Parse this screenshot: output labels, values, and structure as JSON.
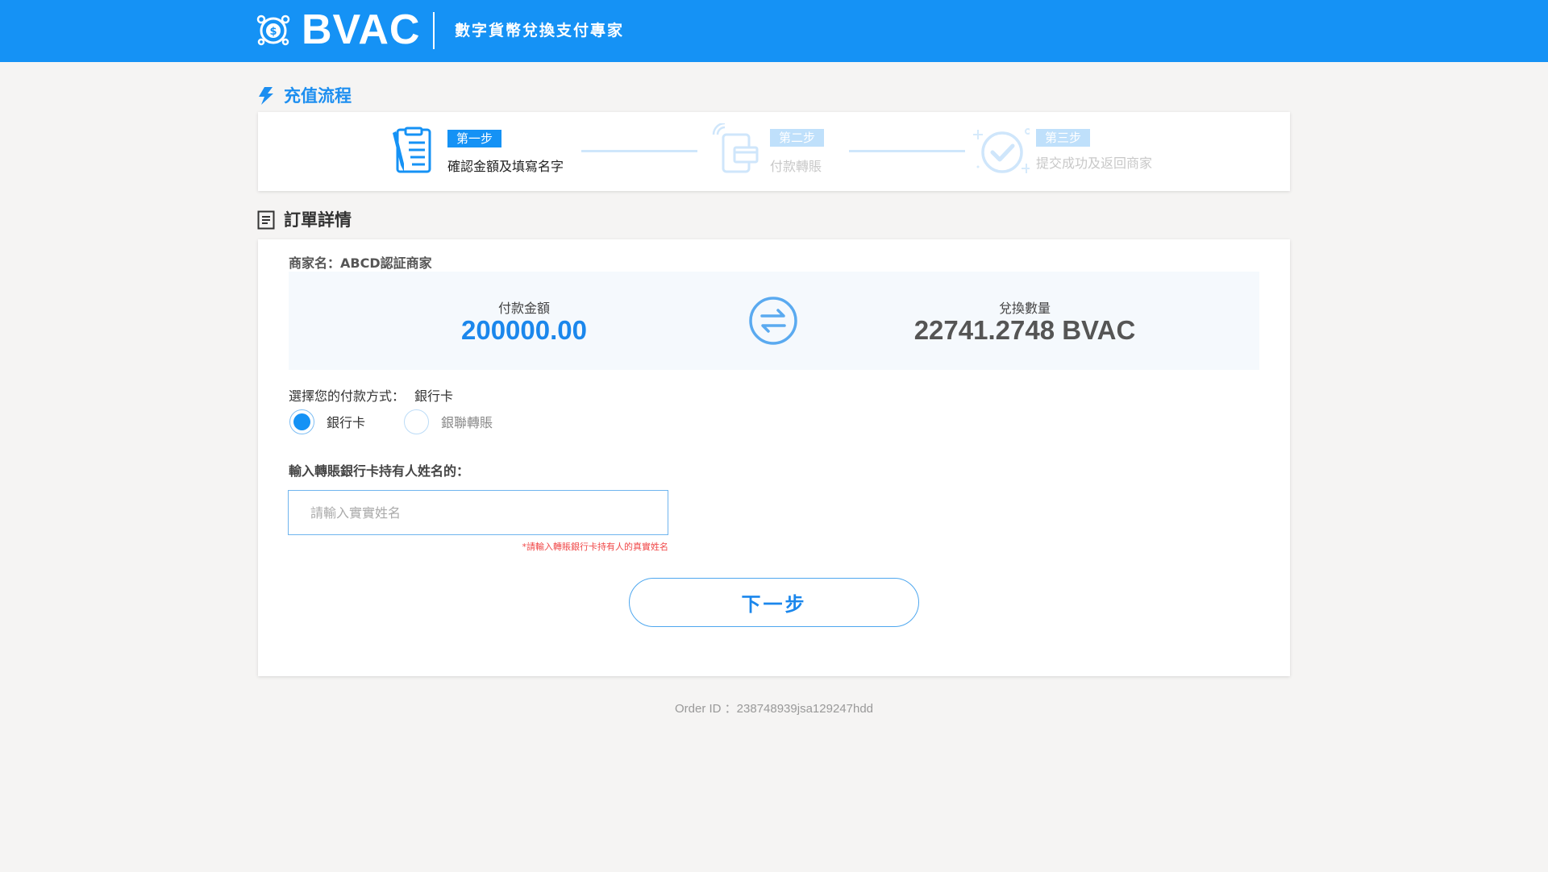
{
  "header": {
    "brand": "BVAC",
    "tagline": "數字貨幣兌換支付專家",
    "background_color": "#1592f5"
  },
  "process": {
    "title": "充值流程",
    "title_icon": "lightning-icon",
    "steps": [
      {
        "badge": "第一步",
        "label": "確認金額及填寫名字",
        "icon": "document-form-icon",
        "active": true
      },
      {
        "badge": "第二步",
        "label": "付款轉賬",
        "icon": "wireless-card-payment-icon",
        "active": false
      },
      {
        "badge": "第三步",
        "label": "提交成功及返回商家",
        "icon": "check-circle-icon",
        "active": false
      }
    ]
  },
  "order": {
    "title": "訂單詳情",
    "title_icon": "list-document-icon",
    "merchant": "商家名：ABCD認証商家",
    "payment_amount_label": "付款金額",
    "payment_amount": "200000.00",
    "exchange_label": "兌換數量",
    "exchange_amount": "22741.2748 BVAC",
    "swap_icon": "swap-arrows-icon",
    "pay_method_label": "選擇您的付款方式：",
    "pay_method_selected": "銀行卡",
    "pay_options": [
      "銀行卡",
      "銀聯轉賬"
    ],
    "name_label": "輸入轉賬銀行卡持有人姓名的：",
    "name_placeholder": "請輸入實實姓名",
    "name_value": "",
    "name_hint": "*請輸入轉賬銀行卡持有人的真實姓名",
    "next_label": "下一步"
  },
  "footer": {
    "order_id": "Order ID ：238748939jsa129247hdd"
  },
  "colors": {
    "accent": "#1592f5",
    "amount_blue": "#1b87ec",
    "hint_red": "#f04848"
  }
}
